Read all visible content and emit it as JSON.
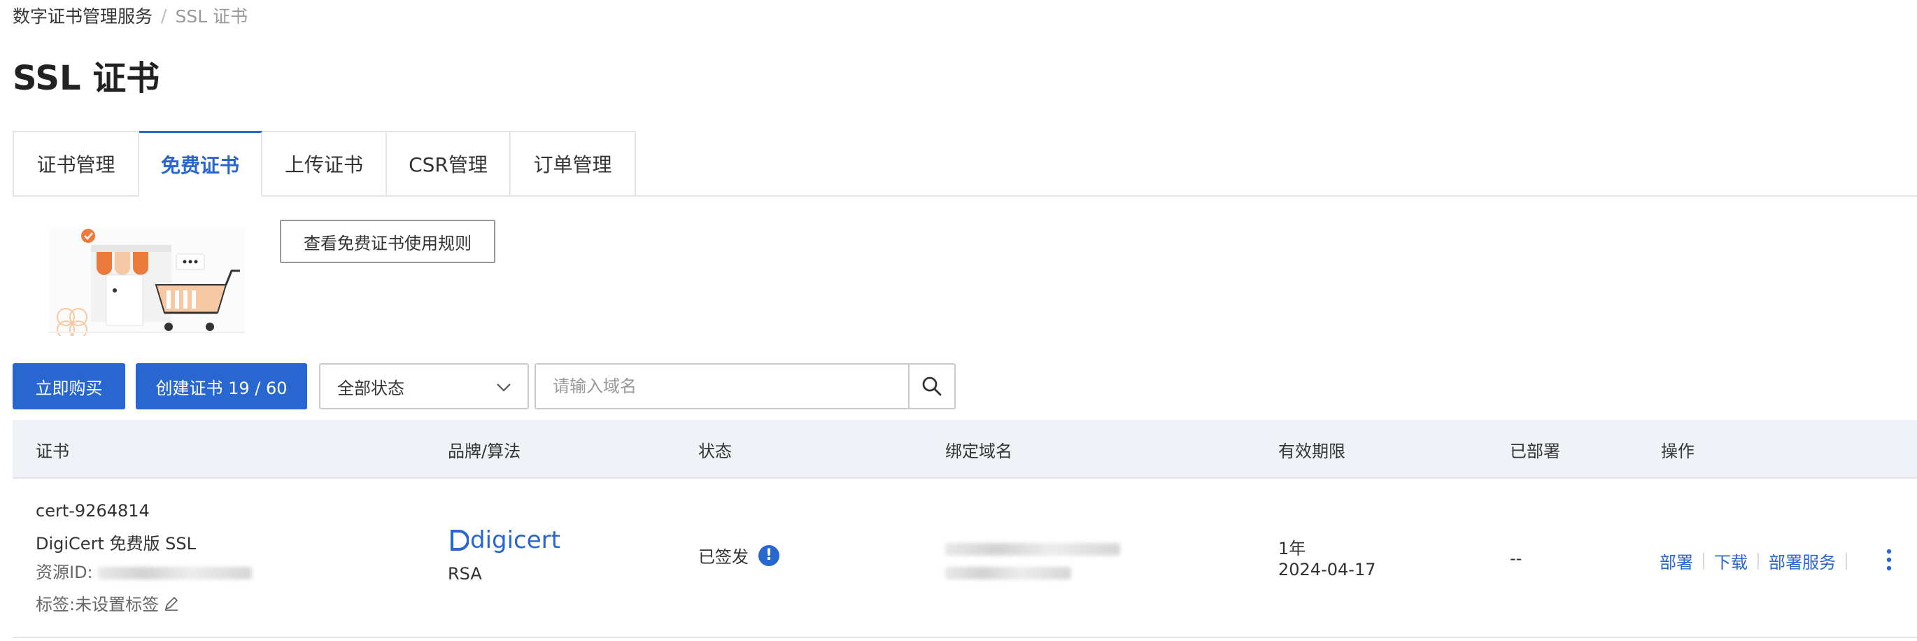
{
  "breadcrumb": {
    "parent": "数字证书管理服务",
    "separator": "/",
    "current": "SSL 证书"
  },
  "page": {
    "title": "SSL 证书"
  },
  "tabs": [
    {
      "label": "证书管理",
      "active": false
    },
    {
      "label": "免费证书",
      "active": true
    },
    {
      "label": "上传证书",
      "active": false
    },
    {
      "label": "CSR管理",
      "active": false
    },
    {
      "label": "订单管理",
      "active": false
    }
  ],
  "banner": {
    "illustration_icon": "shop-cart-illustration",
    "rules_button": "查看免费证书使用规则"
  },
  "toolbar": {
    "buy_label": "立即购买",
    "create_label": "创建证书 19 / 60",
    "status_select": "全部状态",
    "search_placeholder": "请输入域名"
  },
  "table": {
    "headers": [
      "证书",
      "品牌/算法",
      "状态",
      "绑定域名",
      "有效期限",
      "已部署",
      "操作"
    ],
    "rows": [
      {
        "cert_id": "cert-9264814",
        "cert_name": "DigiCert 免费版 SSL",
        "resource_label": "资源ID:",
        "tag_label": "标签:未设置标签",
        "brand": "digicert",
        "algorithm": "RSA",
        "status": "已签发",
        "validity_period": "1年",
        "expiry_date": "2024-04-17",
        "deployed": "--",
        "actions": [
          "部署",
          "下载",
          "部署服务"
        ]
      }
    ]
  },
  "colors": {
    "accent": "#2867d0",
    "border": "#e2e4e8",
    "header_bg": "#eff2f6"
  }
}
